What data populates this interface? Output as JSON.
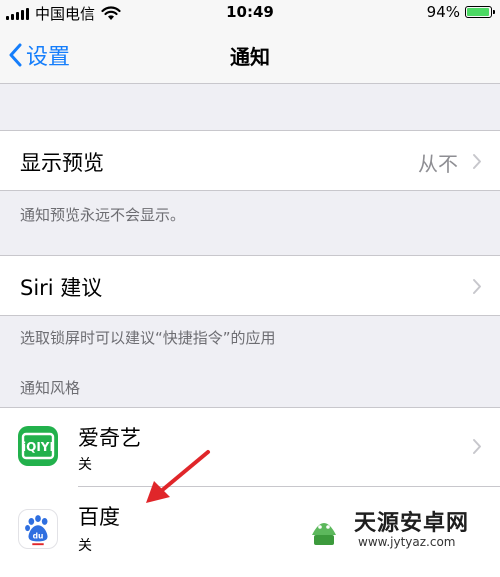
{
  "status": {
    "carrier": "中国电信",
    "time": "10:49",
    "battery_percent": "94%",
    "battery_level": 0.94
  },
  "nav": {
    "back_label": "设置",
    "title": "通知"
  },
  "preview": {
    "label": "显示预览",
    "value": "从不",
    "footer": "通知预览永远不会显示。"
  },
  "siri": {
    "label": "Siri 建议",
    "footer": "选取锁屏时可以建议“快捷指令”的应用"
  },
  "style_section": {
    "header": "通知风格",
    "apps": [
      {
        "name": "爱奇艺",
        "status": "关",
        "icon": "iqiyi-icon"
      },
      {
        "name": "百度",
        "status": "关",
        "icon": "baidu-icon"
      }
    ]
  },
  "watermark": {
    "name": "天源安卓网",
    "url": "www.jytyaz.com"
  },
  "colors": {
    "accent": "#157efb",
    "battery": "#4cd964",
    "iqiyi": "#22b14c",
    "arrow": "#e0262a"
  }
}
